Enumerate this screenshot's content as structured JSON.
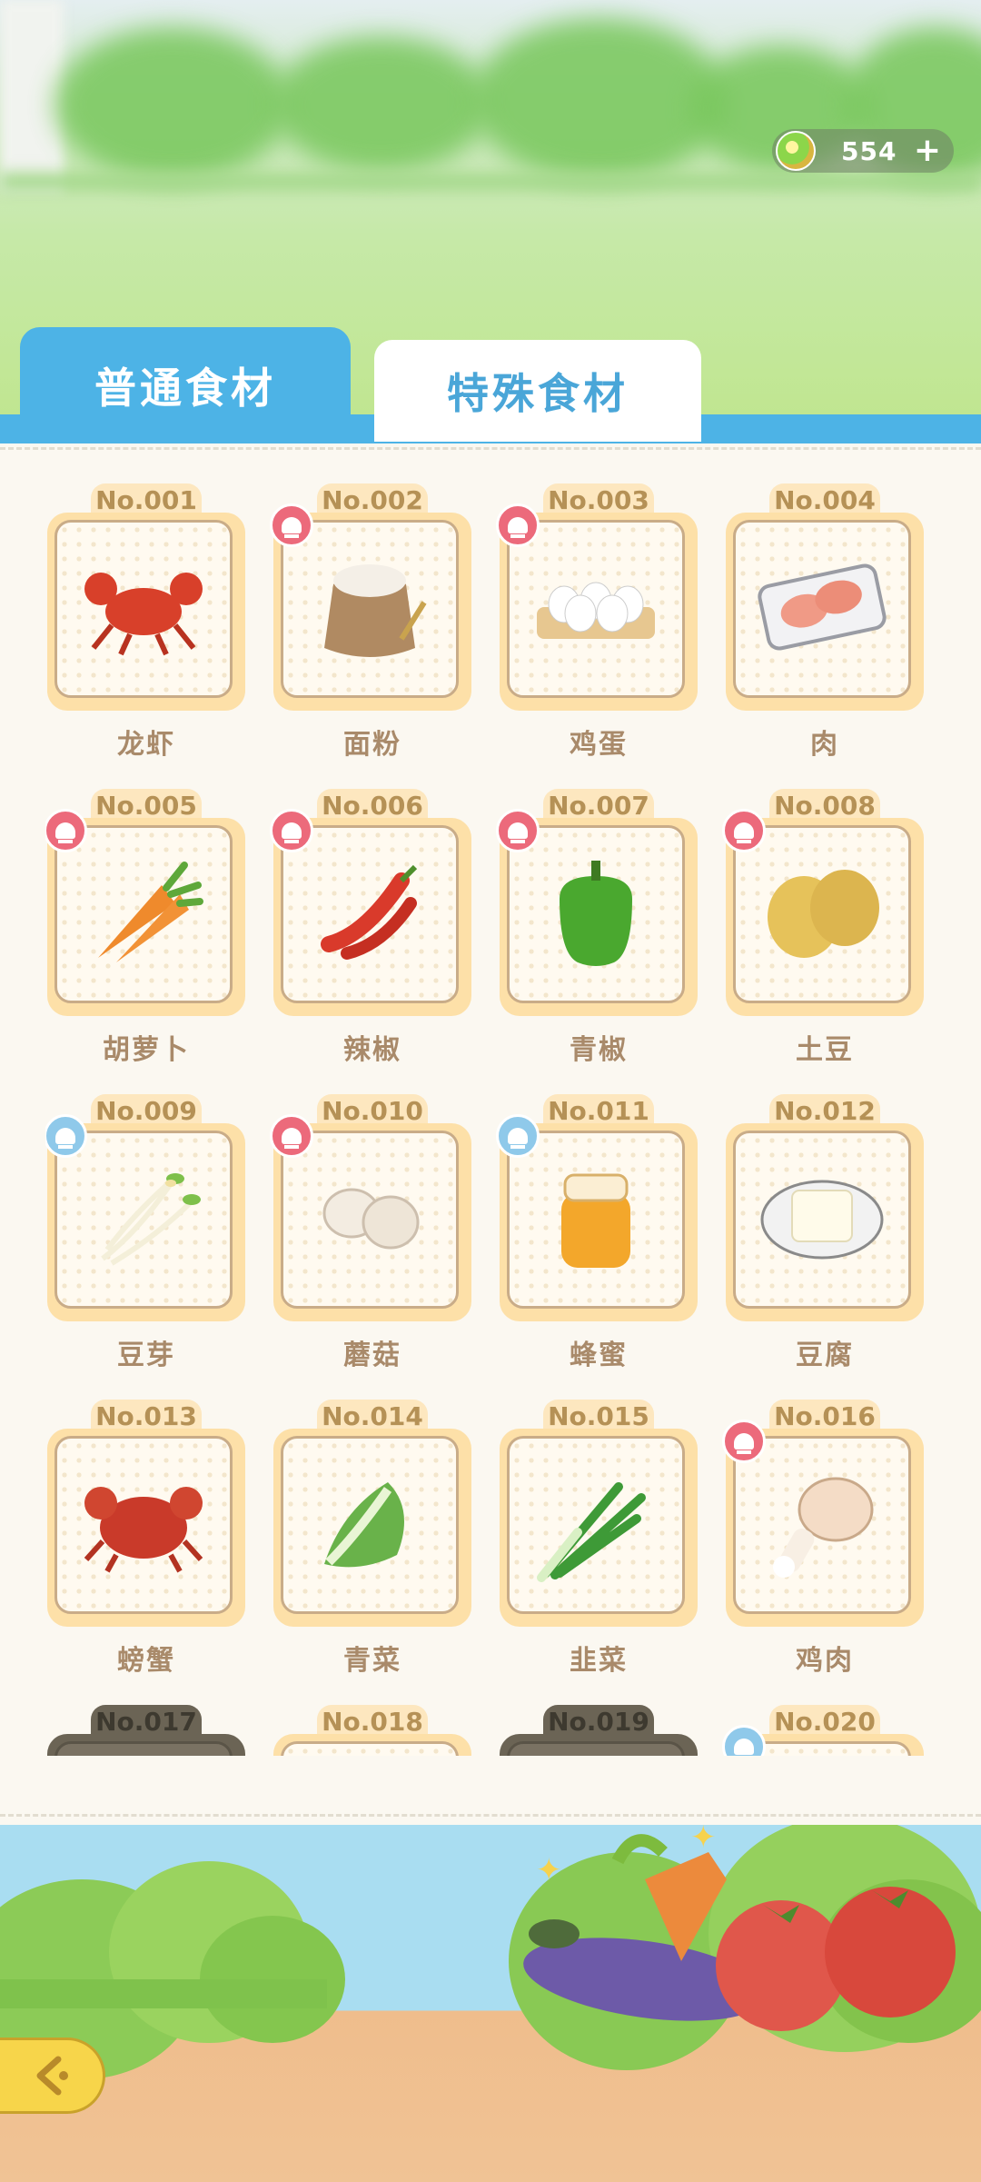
{
  "currency": {
    "amount": "554",
    "plus": "+"
  },
  "tabs": {
    "normal": "普通食材",
    "special": "特殊食材"
  },
  "ingredients": [
    {
      "no": "No.001",
      "name": "龙虾",
      "chef": "",
      "icon": "lobster-icon"
    },
    {
      "no": "No.002",
      "name": "面粉",
      "chef": "red",
      "icon": "flour-sack-icon"
    },
    {
      "no": "No.003",
      "name": "鸡蛋",
      "chef": "red",
      "icon": "egg-tray-icon"
    },
    {
      "no": "No.004",
      "name": "肉",
      "chef": "",
      "icon": "meat-pack-icon"
    },
    {
      "no": "No.005",
      "name": "胡萝卜",
      "chef": "red",
      "icon": "carrot-icon"
    },
    {
      "no": "No.006",
      "name": "辣椒",
      "chef": "red",
      "icon": "chili-icon"
    },
    {
      "no": "No.007",
      "name": "青椒",
      "chef": "red",
      "icon": "green-pepper-icon"
    },
    {
      "no": "No.008",
      "name": "土豆",
      "chef": "red",
      "icon": "potato-icon"
    },
    {
      "no": "No.009",
      "name": "豆芽",
      "chef": "blue",
      "icon": "bean-sprout-icon"
    },
    {
      "no": "No.010",
      "name": "蘑菇",
      "chef": "red",
      "icon": "mushroom-icon"
    },
    {
      "no": "No.011",
      "name": "蜂蜜",
      "chef": "blue",
      "icon": "honey-jar-icon"
    },
    {
      "no": "No.012",
      "name": "豆腐",
      "chef": "",
      "icon": "tofu-icon"
    },
    {
      "no": "No.013",
      "name": "螃蟹",
      "chef": "",
      "icon": "crab-icon"
    },
    {
      "no": "No.014",
      "name": "青菜",
      "chef": "",
      "icon": "bok-choy-icon"
    },
    {
      "no": "No.015",
      "name": "韭菜",
      "chef": "",
      "icon": "leek-icon"
    },
    {
      "no": "No.016",
      "name": "鸡肉",
      "chef": "red",
      "icon": "chicken-leg-icon"
    },
    {
      "no": "No.017",
      "name": "",
      "chef": "",
      "icon": "",
      "locked": true
    },
    {
      "no": "No.018",
      "name": "",
      "chef": "",
      "icon": ""
    },
    {
      "no": "No.019",
      "name": "",
      "chef": "",
      "icon": "",
      "locked": true
    },
    {
      "no": "No.020",
      "name": "",
      "chef": "blue",
      "icon": ""
    }
  ],
  "colors": {
    "accent": "#4db3e6",
    "badge": "#fde7bf",
    "chef_red": "#ec6a7b",
    "chef_blue": "#8fc9ea",
    "back": "#f7d54a"
  }
}
